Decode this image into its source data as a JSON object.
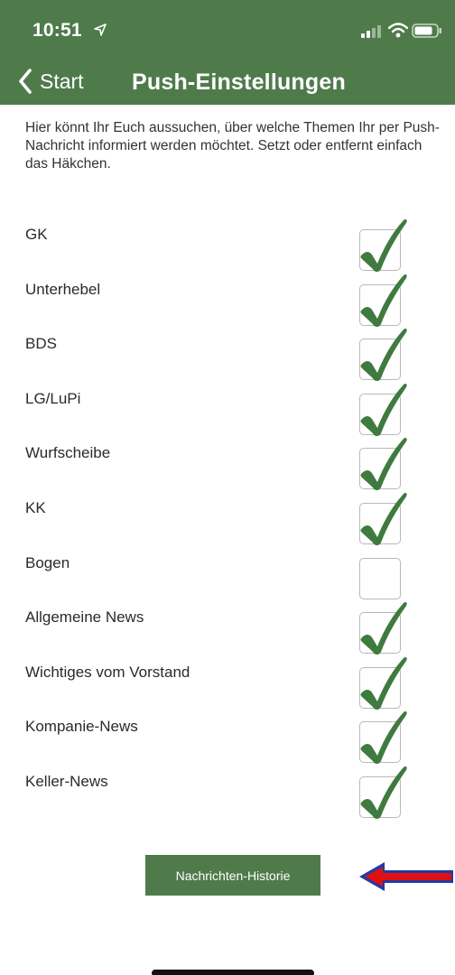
{
  "status_bar": {
    "time": "10:51"
  },
  "nav": {
    "back_label": "Start",
    "title": "Push-Einstellungen"
  },
  "intro": "Hier könnt Ihr Euch aussuchen, über welche Themen Ihr per Push-Nachricht informiert werden möchtet. Setzt oder entfernt einfach das Häkchen.",
  "topics": [
    {
      "label": "GK",
      "checked": true
    },
    {
      "label": "Unterhebel",
      "checked": true
    },
    {
      "label": "BDS",
      "checked": true
    },
    {
      "label": "LG/LuPi",
      "checked": true
    },
    {
      "label": "Wurfscheibe",
      "checked": true
    },
    {
      "label": "KK",
      "checked": true
    },
    {
      "label": "Bogen",
      "checked": false
    },
    {
      "label": "Allgemeine News",
      "checked": true
    },
    {
      "label": "Wichtiges vom Vorstand",
      "checked": true
    },
    {
      "label": "Kompanie-News",
      "checked": true
    },
    {
      "label": "Keller-News",
      "checked": true
    }
  ],
  "history_button": "Nachrichten-Historie",
  "icons": {
    "location": "location-arrow-icon",
    "signal": "cellular-signal-icon",
    "wifi": "wifi-icon",
    "battery": "battery-icon",
    "back": "chevron-left-icon",
    "check": "checkmark-icon",
    "annotation": "red-arrow-icon"
  },
  "colors": {
    "primary": "#4f7b4b",
    "check": "#3f7a3f",
    "annotation_arrow": "#e01010"
  }
}
